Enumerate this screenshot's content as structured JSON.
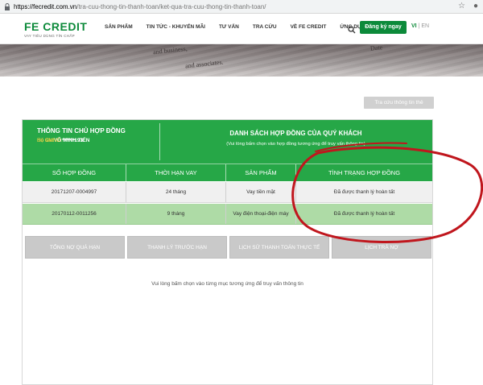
{
  "browser": {
    "url_host": "https://fecredit.com.vn",
    "url_path": "/tra-cuu-thong-tin-thanh-toan/ket-qua-tra-cuu-thong-tin-thanh-toan/",
    "icons": [
      "lock-icon",
      "star-icon",
      "profile-icon"
    ]
  },
  "header": {
    "logo_text": "FE CREDIT",
    "logo_tagline": "VAY TIÊU DÙNG TÍN CHẤP",
    "nav": [
      "SẢN PHẨM",
      "TIN TỨC - KHUYẾN MÃI",
      "TƯ VẤN",
      "TRA CỨU",
      "VỀ FE CREDIT",
      "ỨNG DỤNG"
    ],
    "register_label": "Đăng ký ngay",
    "lang_active": "VI",
    "lang_separator": "|",
    "lang_other": "EN"
  },
  "banner": {
    "texts": [
      "and business,",
      "and associates.",
      "Date"
    ]
  },
  "lookup_button": "Tra cứu thông tin thẻ",
  "owner": {
    "title": "THÔNG TIN CHỦ HỢP ĐỒNG",
    "name_label": "Họ tên:",
    "name_value": "VÕ MINH TIẾN",
    "id_label": "Số CMND:",
    "id_value": "******193"
  },
  "contracts": {
    "title": "DANH SÁCH HỢP ĐỒNG CỦA QUÝ KHÁCH",
    "subtitle": "(Vui lòng bấm chọn vào hợp đồng tương ứng để truy vấn thông tin)",
    "columns": [
      "SỐ HỢP ĐỒNG",
      "THỜI HẠN VAY",
      "SẢN PHẨM",
      "TÌNH TRẠNG HỢP ĐỒNG"
    ],
    "rows": [
      [
        "20171207-0004997",
        "24 tháng",
        "Vay tiền mặt",
        "Đã được thanh lý hoàn tất"
      ],
      [
        "20170112-0011256",
        "9 tháng",
        "Vay điện thoại-điện máy",
        "Đã được thanh lý hoàn tất"
      ]
    ]
  },
  "tabs": [
    "TỔNG NỢ QUÁ HẠN",
    "THANH LÝ TRƯỚC HẠN",
    "LỊCH SỬ THANH TOÁN THỰC TẾ",
    "LỊCH TRẢ NỢ"
  ],
  "tab_info": "Vui lòng bấm chọn vào từng mục tương ứng để truy vấn thông tin",
  "colors": {
    "brand_green": "#0c8a3a",
    "table_green": "#26a747",
    "selected_row": "#aedba6",
    "annotation_red": "#c0161d"
  }
}
